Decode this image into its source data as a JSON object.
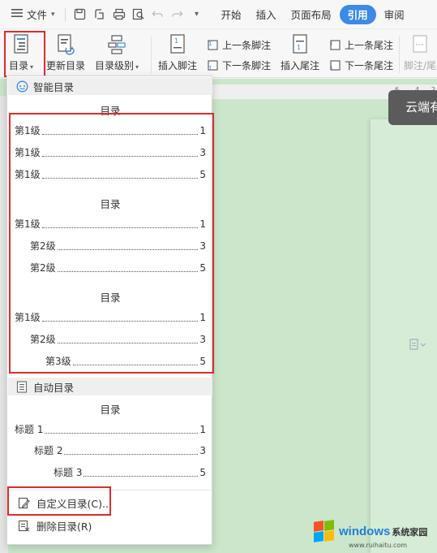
{
  "menubar": {
    "file_label": "文件",
    "tabs": [
      {
        "label": "开始",
        "active": false
      },
      {
        "label": "插入",
        "active": false
      },
      {
        "label": "页面布局",
        "active": false
      },
      {
        "label": "引用",
        "active": true
      },
      {
        "label": "审阅",
        "active": false
      }
    ]
  },
  "ribbon": {
    "toc_label": "目录",
    "update_toc_label": "更新目录",
    "toc_level_label": "目录级别",
    "insert_footnote_label": "插入脚注",
    "prev_footnote_label": "上一条脚注",
    "next_footnote_label": "下一条脚注",
    "insert_endnote_label": "插入尾注",
    "prev_endnote_label": "上一条尾注",
    "next_endnote_label": "下一条尾注",
    "footnote_endnote_label": "脚注/尾"
  },
  "document": {
    "ruler_numbers": [
      "6",
      "4",
      "2"
    ],
    "cloud_tip": "云端有"
  },
  "dropdown": {
    "smart_toc": {
      "header": "智能目录",
      "options": [
        {
          "title": "目录",
          "rows": [
            {
              "text": "第1级",
              "page": "1"
            },
            {
              "text": "第1级",
              "page": "3"
            },
            {
              "text": "第1级",
              "page": "5"
            }
          ]
        },
        {
          "title": "目录",
          "rows": [
            {
              "text": "第1级",
              "page": "1"
            },
            {
              "text": "第2级",
              "page": "3"
            },
            {
              "text": "第2级",
              "page": "5"
            }
          ]
        },
        {
          "title": "目录",
          "rows": [
            {
              "text": "第1级",
              "page": "1"
            },
            {
              "text": "第2级",
              "page": "3"
            },
            {
              "text": "第3级",
              "page": "5"
            }
          ]
        }
      ]
    },
    "auto_toc": {
      "header": "自动目录",
      "title": "目录",
      "rows": [
        {
          "text": "标题 1",
          "page": "1"
        },
        {
          "text": "标题 2",
          "page": "3"
        },
        {
          "text": "标题 3",
          "page": "5"
        }
      ]
    },
    "custom_toc_label": "自定义目录(C)...",
    "delete_toc_label": "删除目录(R)"
  },
  "watermark": {
    "brand": "windows",
    "suffix": "系统家园",
    "url": "www.ruihaitu.com"
  },
  "colors": {
    "accent": "#3c89e8",
    "highlight_border": "#e02b2b",
    "doc_background": "#cbe6cb"
  }
}
